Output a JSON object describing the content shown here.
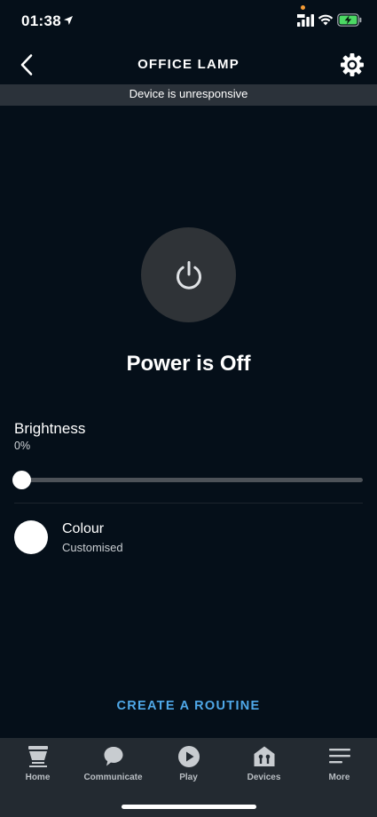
{
  "status_bar": {
    "time": "01:38",
    "privacy_dot_color": "#f59b34",
    "battery_color": "#4cd964",
    "icons": [
      "location-arrow-icon",
      "signal-icon",
      "wifi-icon",
      "battery-charging-icon"
    ]
  },
  "header": {
    "title": "OFFICE LAMP",
    "back_icon": "chevron-left-icon",
    "settings_icon": "gear-icon"
  },
  "banner": {
    "text": "Device is unresponsive"
  },
  "power": {
    "status": "Power is Off",
    "icon": "power-icon"
  },
  "brightness": {
    "label": "Brightness",
    "value_text": "0%",
    "value_percent": 0
  },
  "colour": {
    "label": "Colour",
    "value": "Customised",
    "swatch_color": "#ffffff"
  },
  "routine": {
    "label": "CREATE A ROUTINE",
    "color": "#4fa8e8"
  },
  "tabs": [
    {
      "label": "Home",
      "icon": "home-icon"
    },
    {
      "label": "Communicate",
      "icon": "chat-bubble-icon"
    },
    {
      "label": "Play",
      "icon": "play-icon"
    },
    {
      "label": "Devices",
      "icon": "devices-icon"
    },
    {
      "label": "More",
      "icon": "menu-icon"
    }
  ]
}
